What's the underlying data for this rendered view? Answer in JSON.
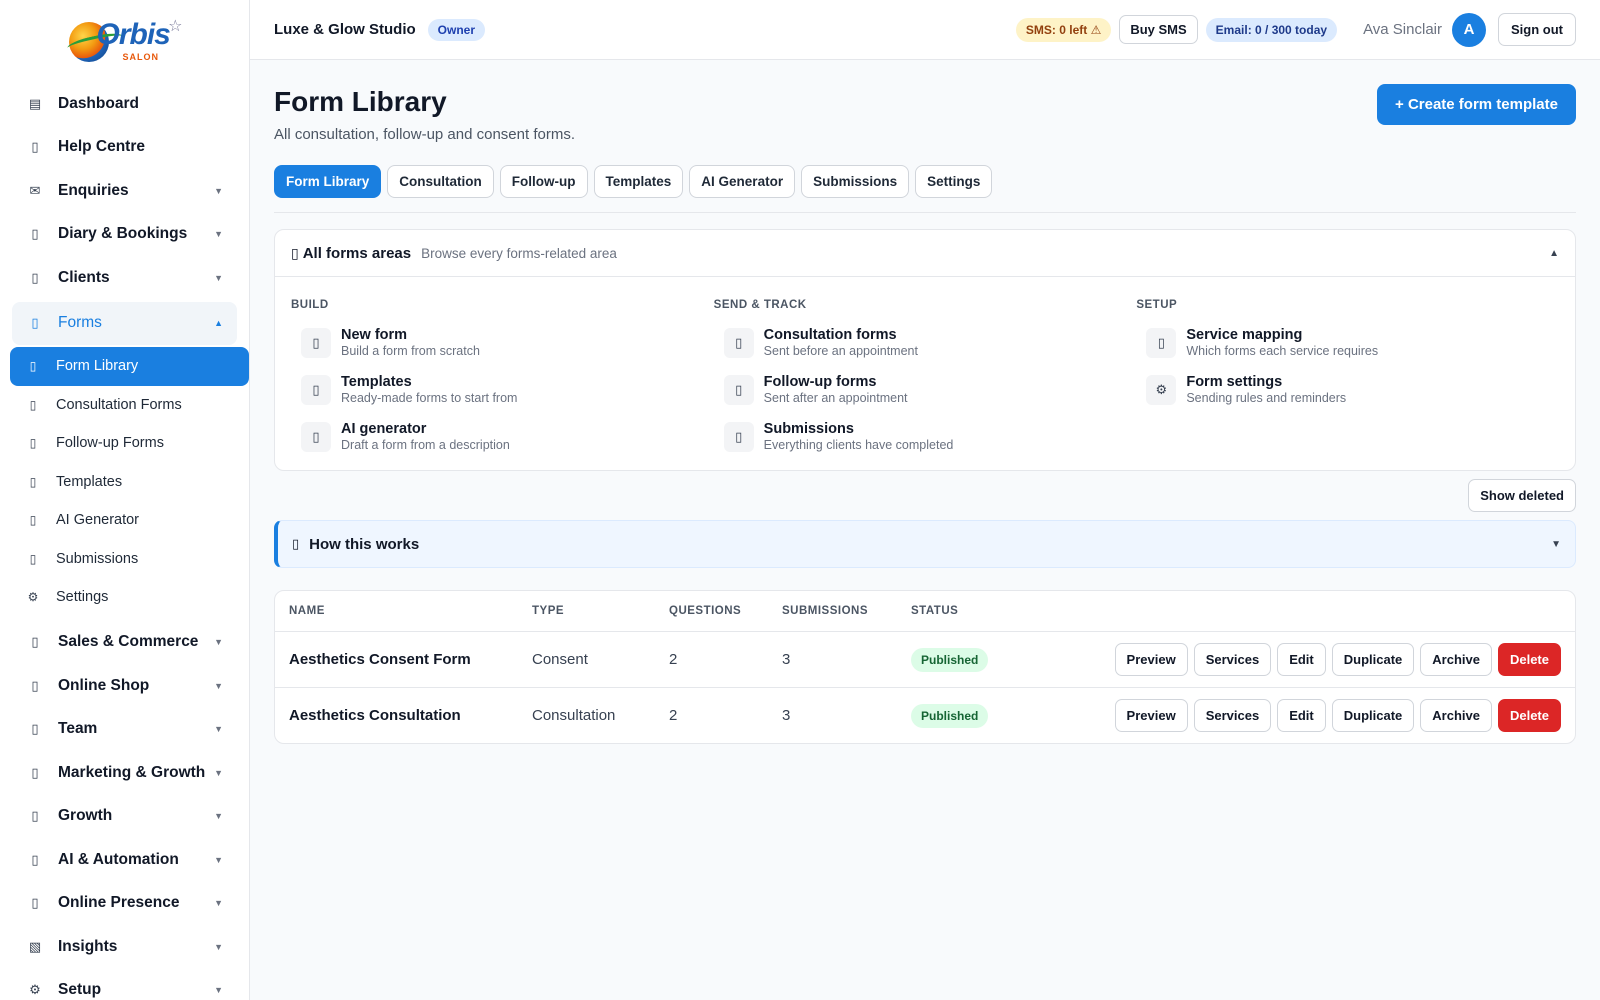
{
  "brand": {
    "logo_text": "Orbis",
    "logo_subtext": "SALON"
  },
  "sidebar": {
    "items": [
      {
        "label": "Dashboard",
        "icon": "dashboard-icon",
        "glyph": "▤",
        "caret": ""
      },
      {
        "label": "Help Centre",
        "icon": "help-icon",
        "glyph": "▯",
        "caret": ""
      },
      {
        "label": "Enquiries",
        "icon": "mail-icon",
        "glyph": "✉",
        "caret": "▼"
      },
      {
        "label": "Diary & Bookings",
        "icon": "calendar-icon",
        "glyph": "▯",
        "caret": "▼"
      },
      {
        "label": "Clients",
        "icon": "clients-icon",
        "glyph": "▯",
        "caret": "▼"
      },
      {
        "label": "Forms",
        "icon": "forms-icon",
        "glyph": "▯",
        "caret": "▲"
      }
    ],
    "forms_sub": [
      {
        "label": "Form Library",
        "icon": "library-icon",
        "glyph": "▯"
      },
      {
        "label": "Consultation Forms",
        "icon": "consultation-icon",
        "glyph": "▯"
      },
      {
        "label": "Follow-up Forms",
        "icon": "follow-up-icon",
        "glyph": "▯"
      },
      {
        "label": "Templates",
        "icon": "templates-icon",
        "glyph": "▯"
      },
      {
        "label": "AI Generator",
        "icon": "ai-icon",
        "glyph": "▯"
      },
      {
        "label": "Submissions",
        "icon": "submissions-icon",
        "glyph": "▯"
      },
      {
        "label": "Settings",
        "icon": "gear-icon",
        "glyph": "⚙"
      }
    ],
    "items_after": [
      {
        "label": "Sales & Commerce",
        "icon": "sales-icon",
        "glyph": "▯",
        "caret": "▼"
      },
      {
        "label": "Online Shop",
        "icon": "shop-icon",
        "glyph": "▯",
        "caret": "▼"
      },
      {
        "label": "Team",
        "icon": "team-icon",
        "glyph": "▯",
        "caret": "▼"
      },
      {
        "label": "Marketing & Growth",
        "icon": "marketing-icon",
        "glyph": "▯",
        "caret": "▼"
      },
      {
        "label": "Growth",
        "icon": "growth-icon",
        "glyph": "▯",
        "caret": "▼"
      },
      {
        "label": "AI & Automation",
        "icon": "automation-icon",
        "glyph": "▯",
        "caret": "▼"
      },
      {
        "label": "Online Presence",
        "icon": "web-icon",
        "glyph": "▯",
        "caret": "▼"
      },
      {
        "label": "Insights",
        "icon": "insights-icon",
        "glyph": "▧",
        "caret": "▼"
      },
      {
        "label": "Setup",
        "icon": "gear-icon",
        "glyph": "⚙",
        "caret": "▼"
      }
    ]
  },
  "topbar": {
    "studio_name": "Luxe & Glow Studio",
    "role_badge": "Owner",
    "sms_status": "SMS: 0 left ⚠",
    "buy_sms": "Buy SMS",
    "email_status": "Email: 0 / 300 today",
    "user_name": "Ava Sinclair",
    "avatar_initial": "A",
    "sign_out": "Sign out"
  },
  "page": {
    "title": "Form Library",
    "subtitle": "All consultation, follow-up and consent forms.",
    "create_button": "+ Create form template"
  },
  "tabs": [
    "Form Library",
    "Consultation",
    "Follow-up",
    "Templates",
    "AI Generator",
    "Submissions",
    "Settings"
  ],
  "areas_panel": {
    "icon": "folder-icon",
    "title": "All forms areas",
    "description": "Browse every forms-related area",
    "caret": "▲",
    "columns": [
      {
        "heading": "BUILD",
        "items": [
          {
            "name": "New form",
            "desc": "Build a form from scratch",
            "icon": "new-form-icon",
            "glyph": "▯"
          },
          {
            "name": "Templates",
            "desc": "Ready-made forms to start from",
            "icon": "templates-icon",
            "glyph": "▯"
          },
          {
            "name": "AI generator",
            "desc": "Draft a form from a description",
            "icon": "ai-icon",
            "glyph": "▯"
          }
        ]
      },
      {
        "heading": "SEND & TRACK",
        "items": [
          {
            "name": "Consultation forms",
            "desc": "Sent before an appointment",
            "icon": "consultation-icon",
            "glyph": "▯"
          },
          {
            "name": "Follow-up forms",
            "desc": "Sent after an appointment",
            "icon": "follow-up-icon",
            "glyph": "▯"
          },
          {
            "name": "Submissions",
            "desc": "Everything clients have completed",
            "icon": "submissions-icon",
            "glyph": "▯"
          }
        ]
      },
      {
        "heading": "SETUP",
        "items": [
          {
            "name": "Service mapping",
            "desc": "Which forms each service requires",
            "icon": "mapping-icon",
            "glyph": "▯"
          },
          {
            "name": "Form settings",
            "desc": "Sending rules and reminders",
            "icon": "gear-icon",
            "glyph": "⚙"
          }
        ]
      }
    ]
  },
  "show_deleted": "Show deleted",
  "how_it_works": {
    "title": "How this works",
    "caret": "▼",
    "icon": "info-icon"
  },
  "table": {
    "headers": [
      "NAME",
      "TYPE",
      "QUESTIONS",
      "SUBMISSIONS",
      "STATUS"
    ],
    "rows": [
      {
        "name": "Aesthetics Consent Form",
        "type": "Consent",
        "questions": "2",
        "submissions": "3",
        "status": "Published"
      },
      {
        "name": "Aesthetics Consultation",
        "type": "Consultation",
        "questions": "2",
        "submissions": "3",
        "status": "Published"
      }
    ],
    "actions": [
      "Preview",
      "Services",
      "Edit",
      "Duplicate",
      "Archive",
      "Delete"
    ]
  },
  "colors": {
    "accent": "#1a7fe0",
    "danger": "#dc2626",
    "success_bg": "#dcfce7",
    "success_text": "#166534"
  }
}
